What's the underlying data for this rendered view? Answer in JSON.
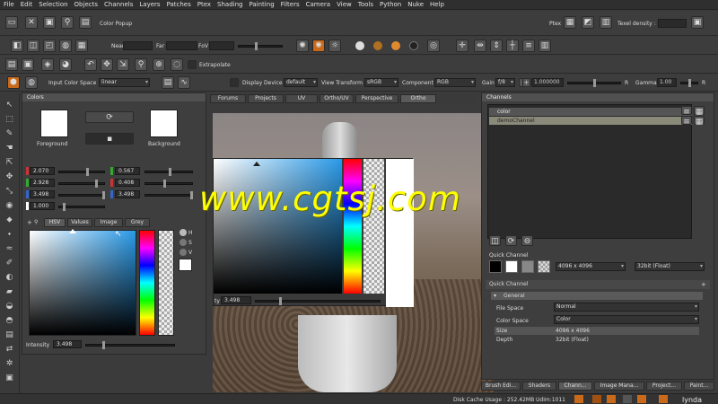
{
  "menu": [
    "File",
    "Edit",
    "Selection",
    "Objects",
    "Channels",
    "Layers",
    "Patches",
    "Ptex",
    "Shading",
    "Painting",
    "Filters",
    "Camera",
    "View",
    "Tools",
    "Python",
    "Nuke",
    "Help"
  ],
  "toolbar1": {
    "popup_label": "Color Popup",
    "ptex_label": "Ptex",
    "texel_density_label": "Texel density :"
  },
  "toolbar2": {
    "near_label": "Near",
    "far_label": "Far",
    "fov_label": "FoV"
  },
  "toolbar3": {
    "extrapolate_label": "Extrapolate"
  },
  "toolbar4": {
    "input_color_space_label": "Input Color Space",
    "input_color_space_value": "linear",
    "display_device_label": "Display Device",
    "display_device_value": "default",
    "view_transform_label": "View Transform",
    "view_transform_value": "sRGB",
    "component_label": "Component",
    "component_value": "RGB",
    "gain_label": "Gain",
    "gain_value": "f/8",
    "gain_number": "1.000000",
    "gamma_label": "Gamma",
    "gamma_value": "1.00",
    "r_label": "R"
  },
  "colors_panel": {
    "title": "Colors",
    "foreground_label": "Foreground",
    "background_label": "Background",
    "values_left": [
      "2.070",
      "2.928",
      "3.498",
      "1.000"
    ],
    "values_right": [
      "0.567",
      "0.408",
      "3.498"
    ],
    "tabs": [
      "HSV",
      "Values",
      "Image",
      "Grey"
    ],
    "hsv_letters": [
      "H",
      "S",
      "V"
    ],
    "intensity_label": "Intensity",
    "intensity_value": "3.498"
  },
  "viewport": {
    "tabs": [
      "Forums",
      "Projects",
      "UV",
      "Ortho/UV",
      "Perspective",
      "Ortho"
    ],
    "popup_value_label": "ty",
    "popup_value": "3.498",
    "watermark": "www.cgtsj.com"
  },
  "channels_panel": {
    "title": "Channels",
    "items": [
      "color",
      "demoChannel"
    ],
    "quick_channel_header": "Quick Channel",
    "quick_size": "4096 x 4096",
    "quick_depth": "32bit (Float)",
    "qc_section": "Quick Channel",
    "general_label": "General",
    "file_space_label": "File Space",
    "file_space_value": "Normal",
    "color_space_label": "Color Space",
    "color_space_value": "Color",
    "size_label": "Size",
    "size_value": "4096 x 4096",
    "depth_label": "Depth",
    "depth_value": "32bit (Float)"
  },
  "bottom_tabs": [
    "Brush Edi...",
    "Shaders",
    "Chann...",
    "Image Mana...",
    "Project...",
    "Paint..."
  ],
  "status": {
    "disk_cache": "Disk Cache Usage : 252.42MB",
    "udim": "Udim:1011",
    "logo": "lynda"
  },
  "colors": {
    "accent_orange": "#c86a1a",
    "selection_blue": "#4a6aa0",
    "watermark_yellow": "#ffff00"
  }
}
